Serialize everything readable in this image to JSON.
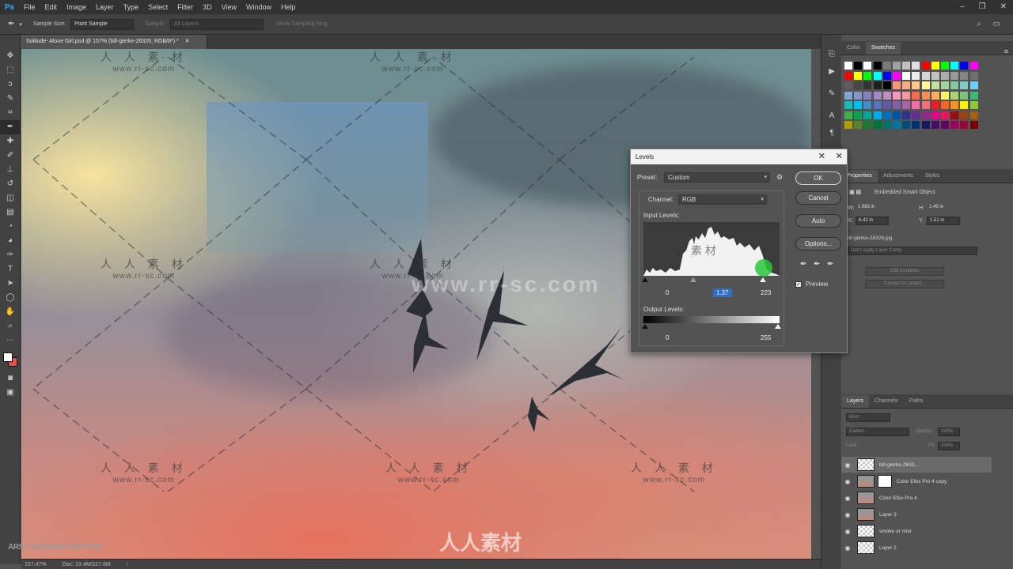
{
  "app": {
    "logo": "Ps",
    "menus": [
      "File",
      "Edit",
      "Image",
      "Layer",
      "Type",
      "Select",
      "Filter",
      "3D",
      "View",
      "Window",
      "Help"
    ]
  },
  "options": {
    "sample_size_label": "Sample Size:",
    "sample_size_value": "Point Sample",
    "sample_label": "Sample:",
    "sample_value": "All Layers",
    "show_ring": "Show Sampling Ring"
  },
  "document": {
    "tab_title": "Solitude- Alone Girl.psd @ 157% (bill-gierke-26326, RGB/8*) *",
    "zoom": "157.47%",
    "doc_size": "Doc: 19.4M/227.6M"
  },
  "watermarks": {
    "cn": "人 人 素 材",
    "url": "www.rr-sc.com",
    "big_url": "www.rr-sc.com",
    "bottom_left": "ARSH VARDHAN ART.COM",
    "bottom_center": "人人素材"
  },
  "levels": {
    "title": "Levels",
    "preset_label": "Preset:",
    "preset_value": "Custom",
    "channel_label": "Channel:",
    "channel_value": "RGB",
    "input_label": "Input Levels:",
    "input_black": "0",
    "input_gamma": "1.37",
    "input_white": "223",
    "output_label": "Output Levels:",
    "output_black": "0",
    "output_white": "255",
    "ok": "OK",
    "cancel": "Cancel",
    "auto": "Auto",
    "options": "Options...",
    "preview": "Preview",
    "histo_wm": "素 材"
  },
  "swatches_panel": {
    "tabs": [
      "Color",
      "Swatches"
    ]
  },
  "properties_panel": {
    "tabs": [
      "Properties",
      "Adjustments",
      "Styles"
    ],
    "type": "Embedded Smart Object",
    "w_label": "W:",
    "w_value": "1.983 in",
    "h_label": "H:",
    "h_value": "1.49 in",
    "x_label": "X:",
    "x_value": "6.42 in",
    "y_label": "Y:",
    "y_value": "1.51 in",
    "file": "bill-gierke-26326.jpg",
    "layer_comp": "Don't Apply Layer Comp",
    "edit_contents": "Edit Contents",
    "convert": "Convert to Linked..."
  },
  "layers_panel": {
    "tabs": [
      "Layers",
      "Channels",
      "Paths"
    ],
    "kind": "Kind",
    "blend": "Darken",
    "opacity_label": "Opacity:",
    "opacity": "100%",
    "lock_label": "Lock:",
    "fill_label": "Fill:",
    "fill": "100%",
    "layers": [
      {
        "name": "bill-gierke-2632...",
        "selected": true
      },
      {
        "name": "Color Efex Pro 4 copy",
        "selected": false
      },
      {
        "name": "Color Efex Pro 4",
        "selected": false
      },
      {
        "name": "Layer 3",
        "selected": false
      },
      {
        "name": "smoke or mist",
        "selected": false
      },
      {
        "name": "Layer 2",
        "selected": false
      }
    ]
  }
}
